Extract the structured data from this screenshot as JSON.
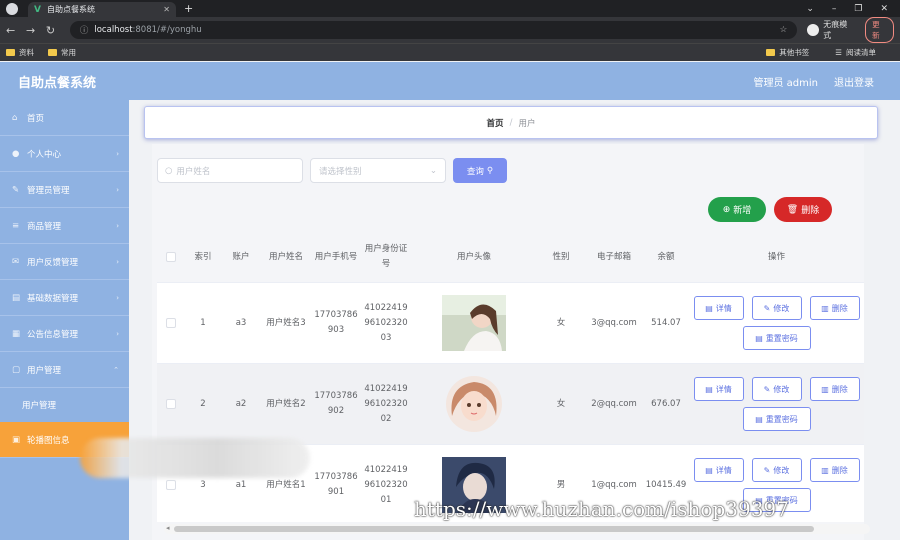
{
  "browser": {
    "tab_title": "自助点餐系统",
    "url_host": "localhost",
    "url_path": ":8081/#/yonghu",
    "incognito_label": "无痕模式",
    "update_label": "更新",
    "bookmarks": [
      "资料",
      "常用"
    ],
    "bookmarks_right": [
      "其他书签",
      "阅读清单"
    ]
  },
  "header": {
    "brand": "自助点餐系统",
    "user": "管理员 admin",
    "logout": "退出登录"
  },
  "sidebar": {
    "items": [
      {
        "label": "首页"
      },
      {
        "label": "个人中心"
      },
      {
        "label": "管理员管理"
      },
      {
        "label": "商品管理"
      },
      {
        "label": "用户反馈管理"
      },
      {
        "label": "基础数据管理"
      },
      {
        "label": "公告信息管理"
      },
      {
        "label": "用户管理"
      }
    ],
    "sub_item": "用户管理",
    "active_item": "轮播图信息"
  },
  "breadcrumb": {
    "home": "首页",
    "sep": "/",
    "current": "用户"
  },
  "filters": {
    "search_placeholder": "用户姓名",
    "select_placeholder": "请选择性别",
    "query_label": "查询"
  },
  "actions": {
    "add_label": "新增",
    "delete_label": "删除"
  },
  "table": {
    "headers": [
      "索引",
      "账户",
      "用户姓名",
      "用户手机号",
      "用户身份证号",
      "用户头像",
      "性别",
      "电子邮箱",
      "余额",
      "操作"
    ],
    "row_actions": {
      "detail": "详情",
      "edit": "修改",
      "delete": "删除",
      "reset": "重置密码"
    },
    "rows": [
      {
        "idx": "1",
        "account": "a3",
        "name": "用户姓名3",
        "phone": "17703786903",
        "idcard": "410224199610232003",
        "sex": "女",
        "email": "3@qq.com",
        "balance": "514.07"
      },
      {
        "idx": "2",
        "account": "a2",
        "name": "用户姓名2",
        "phone": "17703786902",
        "idcard": "410224199610232002",
        "sex": "女",
        "email": "2@qq.com",
        "balance": "676.07"
      },
      {
        "idx": "3",
        "account": "a1",
        "name": "用户姓名1",
        "phone": "17703786901",
        "idcard": "410224199610232001",
        "sex": "男",
        "email": "1@qq.com",
        "balance": "10415.49"
      }
    ]
  },
  "watermark": "https://www.huzhan.com/ishop39397",
  "colors": {
    "sidebar": "#8fb2e2",
    "active": "#f7a23a",
    "primary": "#7b8ef0",
    "add": "#23a04b",
    "delete": "#d62828"
  }
}
